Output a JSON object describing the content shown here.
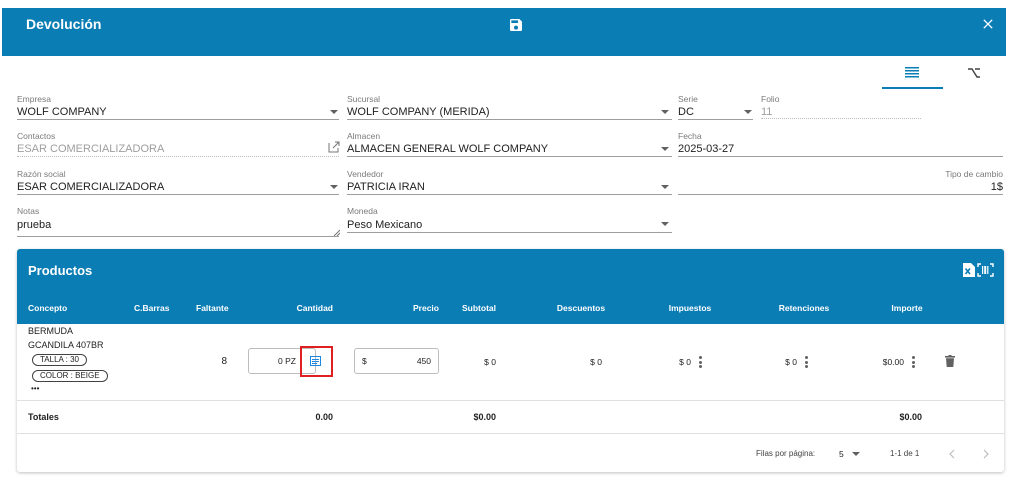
{
  "header": {
    "title": "Devolución"
  },
  "form": {
    "empresa": {
      "label": "Empresa",
      "value": "WOLF COMPANY"
    },
    "sucursal": {
      "label": "Sucursal",
      "value": "WOLF COMPANY (MERIDA)"
    },
    "serie": {
      "label": "Serie",
      "value": "DC"
    },
    "folio": {
      "label": "Folio",
      "value": "11"
    },
    "contactos": {
      "label": "Contactos",
      "value": "ESAR COMERCIALIZADORA"
    },
    "almacen": {
      "label": "Almacen",
      "value": "ALMACEN GENERAL WOLF COMPANY"
    },
    "fecha": {
      "label": "Fecha",
      "value": "2025-03-27"
    },
    "razon_social": {
      "label": "Razón social",
      "value": "ESAR COMERCIALIZADORA"
    },
    "vendedor": {
      "label": "Vendedor",
      "value": "PATRICIA IRAN"
    },
    "tipo_cambio": {
      "label": "Tipo de cambio",
      "value": "1$"
    },
    "notas": {
      "label": "Notas",
      "value": "prueba"
    },
    "moneda": {
      "label": "Moneda",
      "value": "Peso Mexicano"
    }
  },
  "productos": {
    "title": "Productos",
    "columns": {
      "concepto": "Concepto",
      "cbarras": "C.Barras",
      "faltante": "Faltante",
      "cantidad": "Cantidad",
      "precio": "Precio",
      "subtotal": "Subtotal",
      "descuentos": "Descuentos",
      "impuestos": "Impuestos",
      "retenciones": "Retenciones",
      "importe": "Importe"
    },
    "row": {
      "name": "BERMUDA",
      "code": "GCANDILA 407BR",
      "chip1": "TALLA : 30",
      "chip2": "COLOR : BEIGE",
      "more": "•••",
      "faltante": "8",
      "cantidad": "0 PZ",
      "precio_symbol": "$",
      "precio": "450",
      "subtotal": "$ 0",
      "descuentos": "$ 0",
      "impuestos": "$ 0",
      "retenciones": "$ 0",
      "importe": "$0.00"
    },
    "totals": {
      "label": "Totales",
      "cantidad": "0.00",
      "subtotal": "$0.00",
      "importe": "$0.00"
    },
    "pagination": {
      "rows_label": "Filas por página:",
      "rows_value": "5",
      "range": "1-1 de 1"
    }
  },
  "colors": {
    "primary": "#0b7db5",
    "highlight": "#e02020"
  }
}
